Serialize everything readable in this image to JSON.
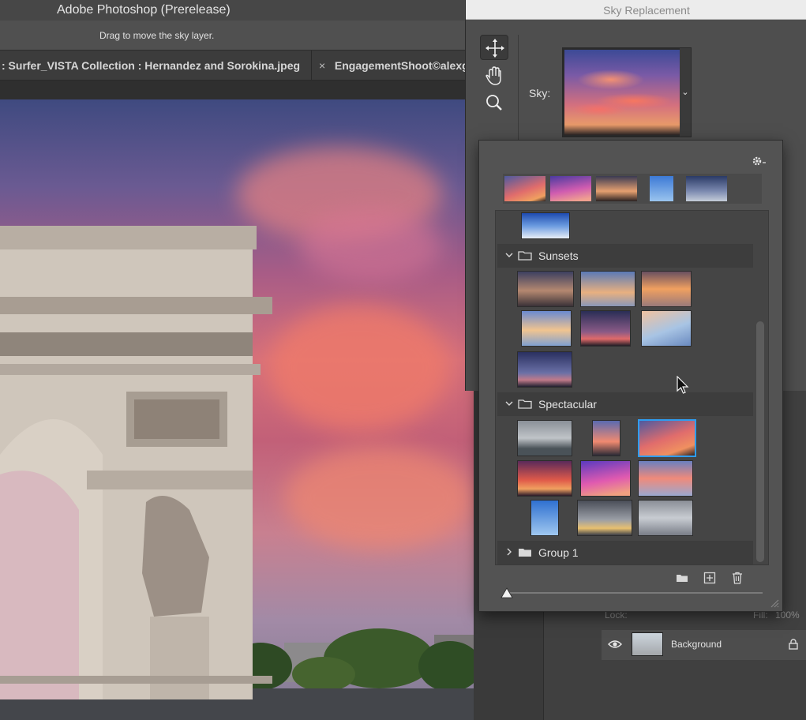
{
  "app": {
    "title": "Adobe Photoshop (Prerelease)",
    "hint": "Drag to move the sky layer."
  },
  "tabs": [
    {
      "label": ": Surfer_VISTA Collection : Hernandez and Sorokina.jpeg",
      "active": true
    },
    {
      "close_glyph": "×",
      "label": "EngagementShoot©alexg",
      "active": false
    }
  ],
  "dialog": {
    "title": "Sky Replacement",
    "sky_label": "Sky:",
    "tools": [
      "move-icon",
      "hand-icon",
      "zoom-icon"
    ],
    "preview_chevron": "⌄"
  },
  "sky_popup": {
    "recent_count_note": "",
    "groups": [
      {
        "label": "Sunsets",
        "expanded": true
      },
      {
        "label": "Spectacular",
        "expanded": true
      },
      {
        "label": "Group 1",
        "expanded": false
      }
    ],
    "selected_preset": "spectacular-3",
    "icons": {
      "gear": "gear-icon",
      "new_group": "folder-icon",
      "add_preset": "add-icon",
      "delete": "trash-icon"
    },
    "thumbnail_size_level": 0.0
  },
  "layers": {
    "lock_label": "Lock:",
    "fill_label": "Fill:",
    "fill_value": "100%",
    "items": [
      {
        "name": "Background",
        "visible": true,
        "locked": true
      }
    ]
  },
  "colors": {
    "selection_accent": "#2f9df0",
    "panel_bg": "#535353",
    "dialog_titlebar": "#ececec"
  }
}
